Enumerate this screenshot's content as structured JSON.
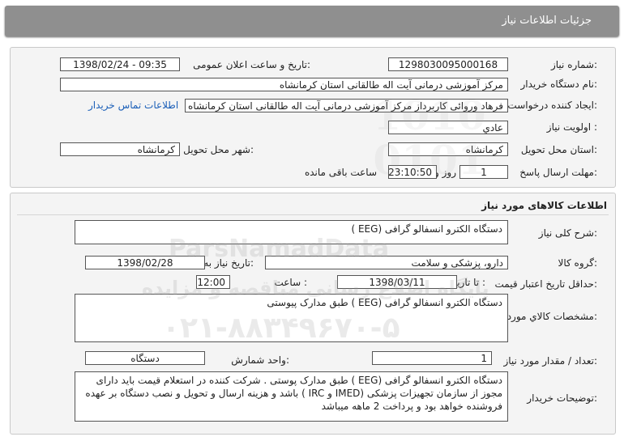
{
  "header": {
    "title": "جزئیات اطلاعات نیاز"
  },
  "info": {
    "need_number_label": "شماره نیاز:",
    "need_number": "1298030095000168",
    "announce_label": "تاریخ و ساعت اعلان عمومی:",
    "announce_value": "1398/02/24 - 09:35",
    "buyer_label": "نام دستگاه خریدار:",
    "buyer_value": "مرکز آموزشی درمانی آیت اله طالقانی استان کرمانشاه",
    "creator_label": "ایجاد کننده درخواست:",
    "creator_value": "فرهاد وروائی کاربرداز مرکز آموزشی درمانی آیت اله طالقانی استان کرمانشاه",
    "contact_link": "اطلاعات تماس خریدار",
    "priority_label": "اولویت نیاز :",
    "priority_value": "عادي",
    "province_label": "استان محل تحویل:",
    "province_value": "کرمانشاه",
    "city_label": "شهر محل تحویل:",
    "city_value": "کرمانشاه",
    "deadline_label": "مهلت ارسال پاسخ:",
    "deadline_days": "1",
    "deadline_days_unit": "روز و",
    "deadline_time": "23:10:50",
    "deadline_remaining": "ساعت باقی مانده"
  },
  "goods": {
    "section_title": "اطلاعات کالاهای مورد نیاز",
    "general_desc_label": "شرح کلی نیاز:",
    "general_desc": "دستگاه الکترو انسفالو گرافی (EEG )",
    "group_label": "گروه کالا:",
    "group_value": "دارو، پزشکی و سلامت",
    "need_date_label": "تاریخ نیاز به کالا:",
    "need_date": "1398/02/28",
    "validity_label": "حداقل تاریخ اعتبار قیمت:",
    "validity_to_label": "تا تاریخ :",
    "validity_date": "1398/03/11",
    "validity_time_label": "ساعت :",
    "validity_time": "12:00",
    "specs_label": "مشخصات کالاي مورد نیاز:",
    "specs_value": "دستگاه الکترو انسفالو گرافی (EEG ) طبق مدارک پیوستی",
    "qty_label": "تعداد / مقدار مورد نیاز:",
    "qty_value": "1",
    "unit_label": "واحد شمارش:",
    "unit_value": "دستگاه",
    "notes_label": "توضیحات خریدار:",
    "notes_value": "دستگاه الکترو انسفالو گرافی (EEG ) طبق مدارک پوستی . شرکت کننده در استعلام قیمت باید دارای مجوز از سازمان تجهیزات پزشکی (IMED و IRC ) باشد و هزینه ارسال و تحویل و نصب دستگاه بر عهده فروشنده خواهد بود و پرداخت 2 ماهه میباشد"
  },
  "watermark": {
    "brand": "ParsNamadData",
    "line1": "پایگاه اطلاع رسانی مناقصه و مزایده",
    "line2": "۰۲۱-۸۸۳۴۹۶۷۰-۵"
  }
}
